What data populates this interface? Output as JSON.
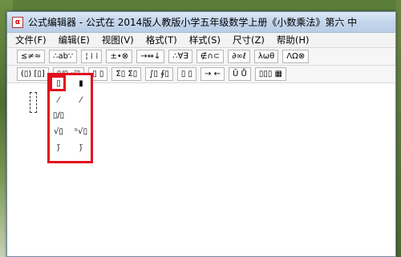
{
  "window": {
    "title": "公式编辑器 - 公式在 2014版人教版小学五年级数学上册《小数乘法》第六 中",
    "app_icon": "equation-editor-icon"
  },
  "menu": [
    {
      "label": "文件(F)"
    },
    {
      "label": "编辑(E)"
    },
    {
      "label": "视图(V)"
    },
    {
      "label": "格式(T)"
    },
    {
      "label": "样式(S)"
    },
    {
      "label": "尺寸(Z)"
    },
    {
      "label": "帮助(H)"
    }
  ],
  "toolbar_row1": [
    {
      "label": "≤≠≈",
      "icon": "relations-palette-icon"
    },
    {
      "label": "∴ab∵",
      "icon": "spaces-palette-icon"
    },
    {
      "label": "¦ ⁞ ⁞",
      "icon": "embellishments-palette-icon"
    },
    {
      "label": "±•⊗",
      "icon": "operators-palette-icon"
    },
    {
      "label": "→⇔↓",
      "icon": "arrows-palette-icon"
    },
    {
      "label": "∴∀∃",
      "icon": "logic-palette-icon"
    },
    {
      "label": "∉∩⊂",
      "icon": "sets-palette-icon"
    },
    {
      "label": "∂∞ℓ",
      "icon": "misc-symbols-palette-icon"
    },
    {
      "label": "λωθ",
      "icon": "greek-lower-palette-icon"
    },
    {
      "label": "ΛΩ⊗",
      "icon": "greek-upper-palette-icon"
    }
  ],
  "toolbar_row2": [
    {
      "label": "(▯) [▯]",
      "icon": "fences-palette-icon"
    },
    {
      "label": "▯/▯ √▯",
      "icon": "fraction-radical-palette-icon"
    },
    {
      "label": "▯ ▯",
      "icon": "subscript-palette-icon"
    },
    {
      "label": "Σ▯ Σ▯",
      "icon": "summation-palette-icon"
    },
    {
      "label": "∫▯ ∮▯",
      "icon": "integral-palette-icon"
    },
    {
      "label": "▯ ▯",
      "icon": "underbar-palette-icon"
    },
    {
      "label": "→ ←",
      "icon": "labeled-arrows-palette-icon"
    },
    {
      "label": "Ū Ů",
      "icon": "products-palette-icon"
    },
    {
      "label": "▯▯▯ ▦",
      "icon": "matrix-palette-icon"
    }
  ],
  "palette": {
    "items": [
      {
        "glyph": "▯",
        "icon": "fraction-full-icon"
      },
      {
        "glyph": "▮",
        "icon": "fraction-small-icon"
      },
      {
        "glyph": "⁄",
        "icon": "slash-fraction-icon"
      },
      {
        "glyph": "⁄",
        "icon": "slash-fraction-small-icon"
      },
      {
        "glyph": "▯/▯",
        "icon": "bevelled-fraction-icon"
      },
      {
        "glyph": "√▯",
        "icon": "square-root-icon"
      },
      {
        "glyph": "ⁿ√▯",
        "icon": "nth-root-icon"
      },
      {
        "glyph": "⟌",
        "icon": "long-division-icon"
      },
      {
        "glyph": "⟌",
        "icon": "long-division-quotient-icon"
      }
    ]
  }
}
